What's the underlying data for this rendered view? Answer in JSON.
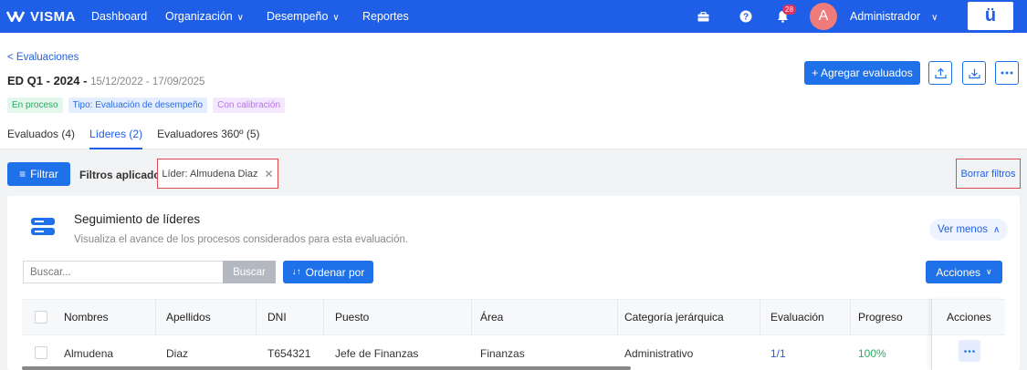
{
  "topbar": {
    "brand": "VISMA",
    "nav": [
      {
        "label": "Dashboard",
        "has_chevron": false
      },
      {
        "label": "Organización",
        "has_chevron": true
      },
      {
        "label": "Desempeño",
        "has_chevron": true
      },
      {
        "label": "Reportes",
        "has_chevron": false
      }
    ],
    "notification_count": "28",
    "avatar_initial": "A",
    "user_name": "Administrador",
    "app_logo": "ü",
    "icons": [
      "briefcase-icon",
      "help-icon",
      "bell-icon",
      "chevron-down-icon"
    ]
  },
  "header": {
    "back_link": "< Evaluaciones",
    "eval_name": "ED Q1 - 2024",
    "eval_sep": " - ",
    "eval_dates": "15/12/2022 - 17/09/2025",
    "tags": [
      "En proceso",
      "Tipo: Evaluación de desempeño",
      "Con calibración"
    ],
    "add_button": "+ Agregar evaluados",
    "tabs": [
      {
        "label": "Evaluados (4)",
        "active": false
      },
      {
        "label": "Líderes (2)",
        "active": true
      },
      {
        "label": "Evaluadores 360º (5)",
        "active": false
      }
    ]
  },
  "filters": {
    "filter_button": "Filtrar",
    "applied_label": "Filtros aplicados:",
    "chip": "Líder: Almudena Diaz",
    "clear": "Borrar filtros"
  },
  "panel": {
    "title": "Seguimiento de líderes",
    "subtitle": "Visualiza el avance de los procesos considerados para esta evaluación.",
    "ver_menos": "Ver menos",
    "search_placeholder": "Buscar...",
    "search_button": "Buscar",
    "sort_button": "Ordenar por",
    "actions_button": "Acciones",
    "columns": [
      "Nombres",
      "Apellidos",
      "DNI",
      "Puesto",
      "Área",
      "Categoría jerárquica",
      "Evaluación",
      "Progreso",
      "Acciones"
    ],
    "rows": [
      {
        "nombres": "Almudena",
        "apellidos": "Diaz",
        "dni": "T654321",
        "puesto": "Jefe de Finanzas",
        "area": "Finanzas",
        "categoria": "Administrativo",
        "evaluacion": "1/1",
        "progreso": "100%"
      }
    ]
  },
  "colors": {
    "primary": "#1f5ee6",
    "topbar": "#1f5ee6",
    "success": "#2eaa62",
    "highlight_border": "#e04a4a"
  }
}
